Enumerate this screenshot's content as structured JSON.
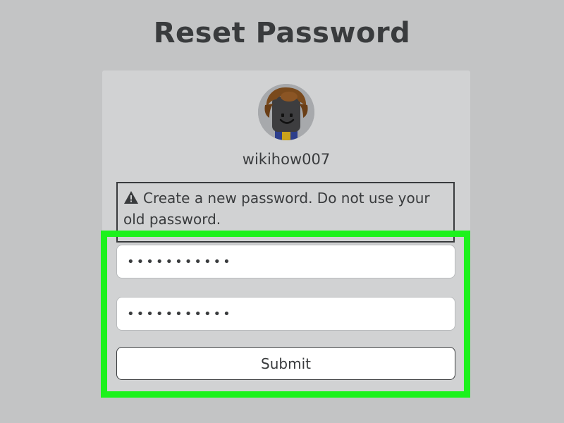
{
  "page": {
    "title": "Reset Password"
  },
  "account": {
    "username": "wikihow007",
    "avatar_icon": "roblox-avatar-icon"
  },
  "notice": {
    "icon": "warning-icon",
    "text": "Create a new password. Do not use your old password."
  },
  "form": {
    "new_password_value": "•••••••••••",
    "confirm_password_value": "•••••••••••",
    "submit_label": "Submit"
  },
  "colors": {
    "background": "#c3c4c5",
    "card": "#d1d2d3",
    "highlight": "#1cf21c",
    "text": "#393b3d"
  }
}
